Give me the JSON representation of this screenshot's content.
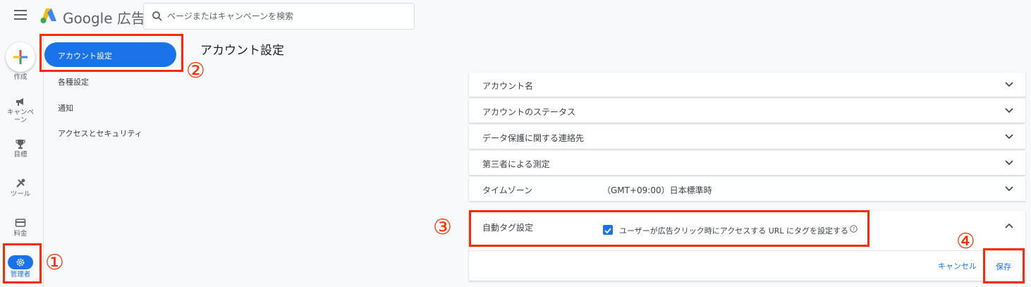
{
  "header": {
    "app_name": "Google 広告",
    "search_placeholder": "ページまたはキャンペーンを検索"
  },
  "rail": {
    "create": "作成",
    "campaigns": "キャンペーン",
    "goals": "目標",
    "tools": "ツール",
    "billing": "料金",
    "admin": "管理者"
  },
  "nav": {
    "items": [
      "アカウント設定",
      "各種設定",
      "通知",
      "アクセスとセキュリティ"
    ]
  },
  "page": {
    "title": "アカウント設定"
  },
  "settings": {
    "rows": [
      {
        "label": "アカウント名",
        "value": ""
      },
      {
        "label": "アカウントのステータス",
        "value": ""
      },
      {
        "label": "データ保護に関する連絡先",
        "value": ""
      },
      {
        "label": "第三者による測定",
        "value": ""
      },
      {
        "label": "タイムゾーン",
        "value": "（GMT+09:00）日本標準時"
      }
    ],
    "auto_tagging": {
      "label": "自動タグ設定",
      "checkbox_label": "ユーザーが広告クリック時にアクセスする URL にタグを設定する",
      "checked": true,
      "cancel": "キャンセル",
      "save": "保存"
    }
  },
  "annotations": {
    "markers": [
      "①",
      "②",
      "③",
      "④"
    ],
    "color": "#ff2a00"
  },
  "colors": {
    "accent": "#1a73e8",
    "annotation": "#ff2a00"
  }
}
